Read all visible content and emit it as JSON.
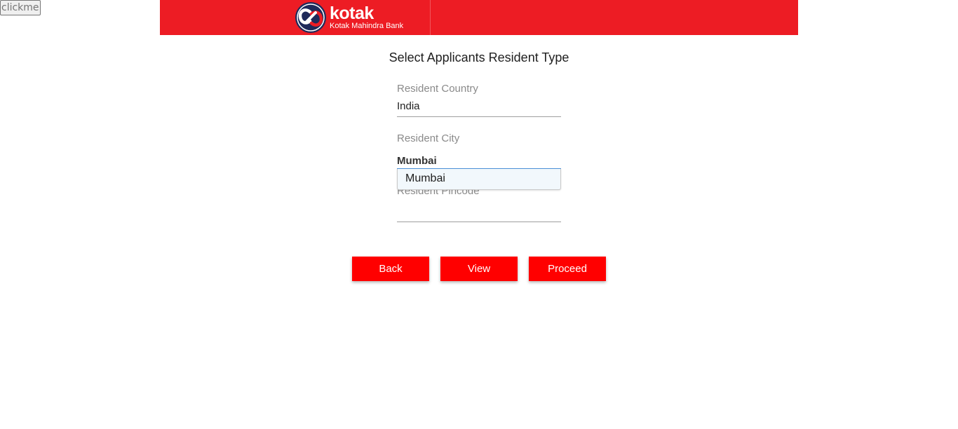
{
  "debug_button": {
    "label": "clickme"
  },
  "header": {
    "logo_word": "kotak",
    "logo_subtitle": "Kotak Mahindra Bank",
    "brand_color": "#ed1c24",
    "logo_navy": "#1f2a5a",
    "logo_icon": "kotak-infinity-logo-icon"
  },
  "form": {
    "title": "Select Applicants Resident Type",
    "country": {
      "label": "Resident Country",
      "value": "India"
    },
    "city": {
      "label": "Resident City",
      "value": "Mumbai",
      "suggestions": [
        "Mumbai"
      ]
    },
    "pincode": {
      "label": "Resident Pincode",
      "value": ""
    }
  },
  "actions": {
    "back_label": "Back",
    "view_label": "View",
    "proceed_label": "Proceed",
    "button_color": "#ff0000"
  }
}
